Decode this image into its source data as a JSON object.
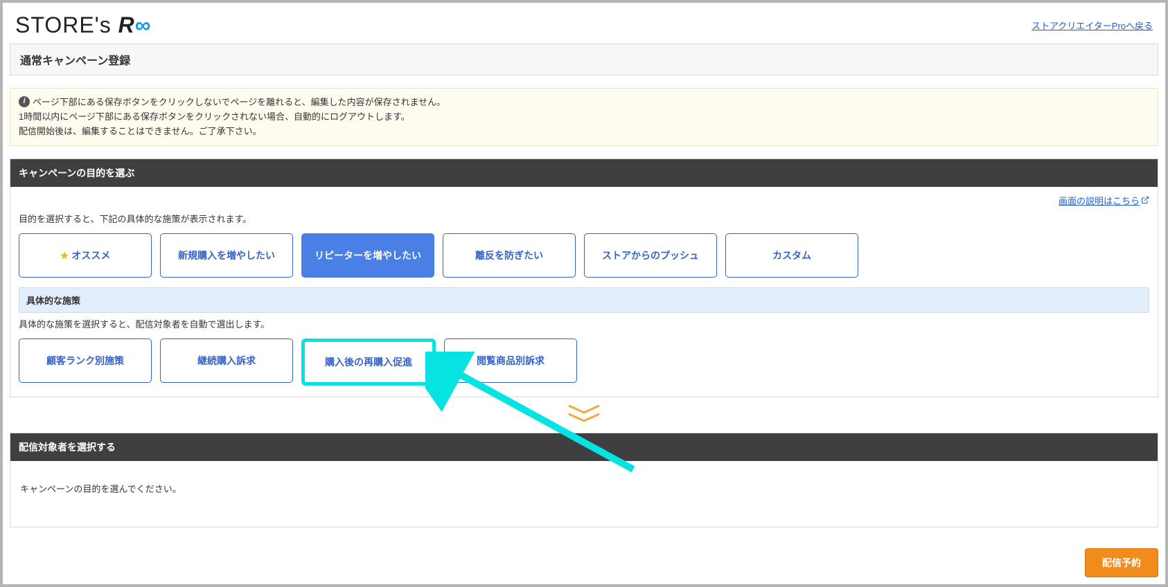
{
  "header": {
    "logo_prefix": "STORE's ",
    "logo_r": "R",
    "logo_inf": "∞",
    "back_link": "ストアクリエイターProへ戻る"
  },
  "page_title": "通常キャンペーン登録",
  "notice": {
    "line1": "ページ下部にある保存ボタンをクリックしないでページを離れると、編集した内容が保存されません。",
    "line2": "1時間以内にページ下部にある保存ボタンをクリックされない場合、自動的にログアウトします。",
    "line3": "配信開始後は、編集することはできません。ご了承下さい。"
  },
  "goal_section": {
    "title": "キャンペーンの目的を選ぶ",
    "help_link": "画面の説明はこちら",
    "desc": "目的を選択すると、下記の具体的な施策が表示されます。",
    "options": [
      {
        "label": "オススメ",
        "star": true
      },
      {
        "label": "新規購入を増やしたい"
      },
      {
        "label": "リピーターを増やしたい",
        "active": true
      },
      {
        "label": "離反を防ぎたい"
      },
      {
        "label": "ストアからのプッシュ"
      },
      {
        "label": "カスタム"
      }
    ],
    "sub_title": "具体的な施策",
    "sub_desc": "具体的な施策を選択すると、配信対象者を自動で選出します。",
    "sub_options": [
      {
        "label": "顧客ランク別施策"
      },
      {
        "label": "継続購入訴求"
      },
      {
        "label": "購入後の再購入促進",
        "highlight": true
      },
      {
        "label": "閲覧商品別訴求"
      }
    ]
  },
  "target_section": {
    "title": "配信対象者を選択する",
    "prompt": "キャンペーンの目的を選んでください。"
  },
  "footer": {
    "submit": "配信予約"
  }
}
